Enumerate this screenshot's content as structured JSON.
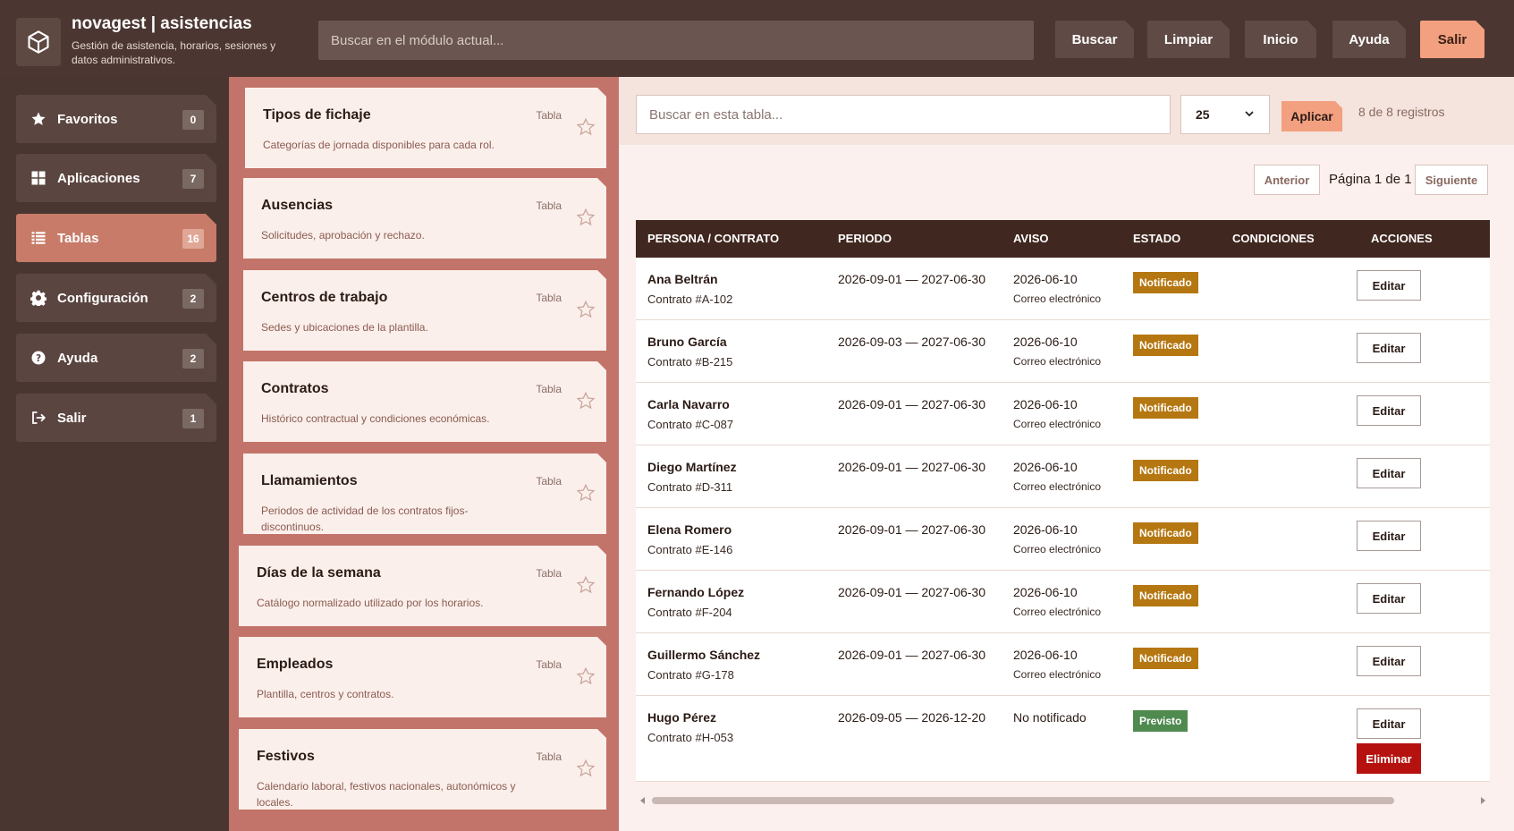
{
  "header": {
    "title": "novagest | asistencias",
    "subtitle": "Gestión de asistencia, horarios, sesiones y datos administrativos.",
    "search_placeholder": "Buscar en el módulo actual...",
    "buttons": [
      "Buscar",
      "Limpiar",
      "Inicio",
      "Ayuda",
      "Salir"
    ]
  },
  "sidebar": {
    "items": [
      {
        "label": "Favoritos",
        "count": "0",
        "icon": "star-icon"
      },
      {
        "label": "Aplicaciones",
        "count": "7",
        "icon": "grid-icon"
      },
      {
        "label": "Tablas",
        "count": "16",
        "icon": "list-icon"
      },
      {
        "label": "Configuración",
        "count": "2",
        "icon": "gear-icon"
      },
      {
        "label": "Ayuda",
        "count": "2",
        "icon": "help-icon"
      },
      {
        "label": "Salir",
        "count": "1",
        "icon": "logout-icon"
      }
    ]
  },
  "tables_list": [
    {
      "title": "Tipos de fichaje",
      "kind": "Tabla",
      "desc": "Categorías de jornada disponibles para cada rol."
    },
    {
      "title": "Ausencias",
      "kind": "Tabla",
      "desc": "Solicitudes, aprobación y rechazo."
    },
    {
      "title": "Centros de trabajo",
      "kind": "Tabla",
      "desc": "Sedes y ubicaciones de la plantilla."
    },
    {
      "title": "Contratos",
      "kind": "Tabla",
      "desc": "Histórico contractual y condiciones económicas."
    },
    {
      "title": "Llamamientos",
      "kind": "Tabla",
      "desc": "Periodos de actividad de los contratos fijos-discontinuos."
    },
    {
      "title": "Días de la semana",
      "kind": "Tabla",
      "desc": "Catálogo normalizado utilizado por los horarios."
    },
    {
      "title": "Empleados",
      "kind": "Tabla",
      "desc": "Plantilla, centros y contratos."
    },
    {
      "title": "Festivos",
      "kind": "Tabla",
      "desc": "Calendario laboral, festivos nacionales, autonómicos y locales."
    }
  ],
  "toolbar": {
    "search_placeholder": "Buscar en esta tabla...",
    "page_size": "25",
    "apply": "Aplicar",
    "records": "8 de 8 registros",
    "prev": "Anterior",
    "page_info": "Página 1 de 1",
    "next": "Siguiente"
  },
  "table": {
    "headers": [
      "PERSONA / CONTRATO",
      "PERIODO",
      "AVISO",
      "ESTADO",
      "CONDICIONES",
      "ACCIONES"
    ],
    "edit_label": "Editar",
    "delete_label": "Eliminar",
    "status_colors": {
      "Notificado": "#b57711",
      "Previsto": "#4f8a4f"
    },
    "rows": [
      {
        "name": "Ana Beltrán",
        "contract": "Contrato #A-102",
        "period": "2026-09-01 — 2027-06-30",
        "notice": "2026-06-10",
        "channel": "Correo electrónico",
        "status": "Notificado"
      },
      {
        "name": "Bruno García",
        "contract": "Contrato #B-215",
        "period": "2026-09-03 — 2027-06-30",
        "notice": "2026-06-10",
        "channel": "Correo electrónico",
        "status": "Notificado"
      },
      {
        "name": "Carla Navarro",
        "contract": "Contrato #C-087",
        "period": "2026-09-01 — 2027-06-30",
        "notice": "2026-06-10",
        "channel": "Correo electrónico",
        "status": "Notificado"
      },
      {
        "name": "Diego Martínez",
        "contract": "Contrato #D-311",
        "period": "2026-09-01 — 2027-06-30",
        "notice": "2026-06-10",
        "channel": "Correo electrónico",
        "status": "Notificado"
      },
      {
        "name": "Elena Romero",
        "contract": "Contrato #E-146",
        "period": "2026-09-01 — 2027-06-30",
        "notice": "2026-06-10",
        "channel": "Correo electrónico",
        "status": "Notificado"
      },
      {
        "name": "Fernando López",
        "contract": "Contrato #F-204",
        "period": "2026-09-01 — 2027-06-30",
        "notice": "2026-06-10",
        "channel": "Correo electrónico",
        "status": "Notificado"
      },
      {
        "name": "Guillermo Sánchez",
        "contract": "Contrato #G-178",
        "period": "2026-09-01 — 2027-06-30",
        "notice": "2026-06-10",
        "channel": "Correo electrónico",
        "status": "Notificado"
      },
      {
        "name": "Hugo Pérez",
        "contract": "Contrato #H-053",
        "period": "2026-09-05 — 2026-12-20",
        "notice": "No notificado",
        "channel": "",
        "status": "Previsto"
      }
    ]
  }
}
